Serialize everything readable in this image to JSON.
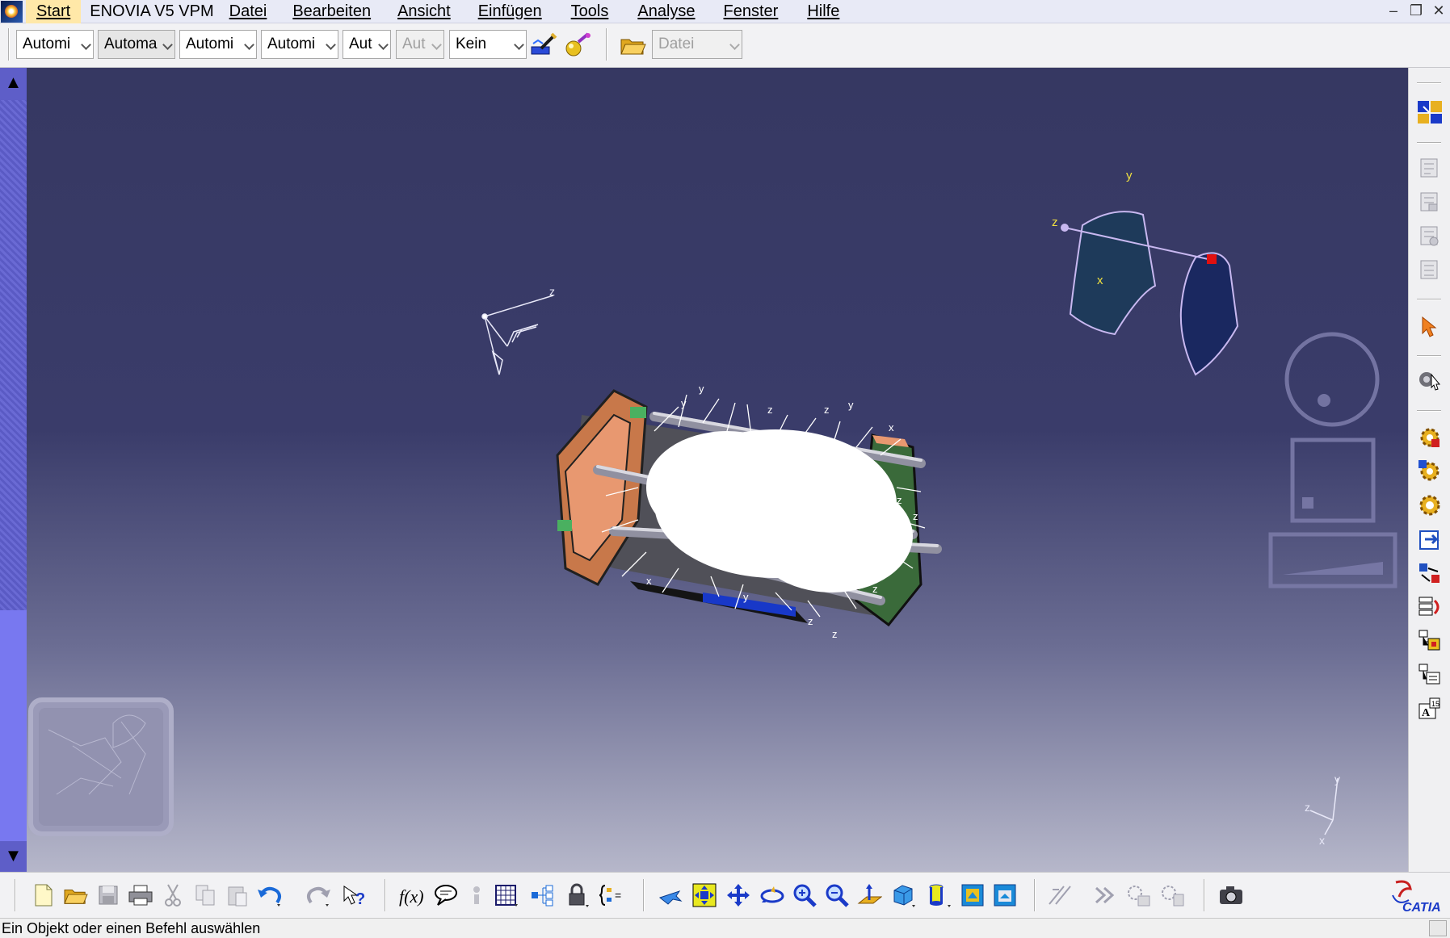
{
  "menubar": {
    "items": [
      "Start",
      "ENOVIA V5 VPM",
      "Datei",
      "Bearbeiten",
      "Ansicht",
      "Einfügen",
      "Tools",
      "Analyse",
      "Fenster",
      "Hilfe"
    ]
  },
  "toolbar_top": {
    "combos": [
      "Automi",
      "Automa",
      "Automi",
      "Automi",
      "Aut",
      "Aut",
      "Kein"
    ],
    "file_combo": "Datei",
    "icons": [
      "format-painter-icon",
      "apply-material-icon",
      "open-folder-icon"
    ]
  },
  "viewport": {
    "background_top": "#363862",
    "background_bottom": "#b6b7ca",
    "compass_labels": {
      "y": "y",
      "z": "z",
      "x": "x"
    },
    "axis_labels": {
      "y": "y",
      "z": "z",
      "x": "x"
    },
    "ref_axis_label": "z"
  },
  "toolbar_right": {
    "icons": [
      "product-structure-icon",
      "component-icon-1",
      "component-icon-2",
      "component-icon-3",
      "component-icon-4",
      "select-arrow-icon",
      "manipulate-icon",
      "gear-icon-1",
      "gear-icon-2",
      "gear-icon-3",
      "import-icon",
      "replace-icon",
      "reorder-icon",
      "graph-tree-icon",
      "multi-instantiate-icon",
      "text-icon"
    ]
  },
  "toolbar_bottom": {
    "icons": [
      "new-icon",
      "open-icon",
      "save-icon",
      "print-icon",
      "cut-icon",
      "copy-icon",
      "paste-icon",
      "undo-icon",
      "redo-icon",
      "whats-this-icon",
      "formula-icon",
      "comment-icon",
      "knowledge-icon",
      "table-icon",
      "tree-icon",
      "lock-icon",
      "parameters-icon",
      "fly-mode-icon",
      "fit-all-icon",
      "pan-icon",
      "rotate-icon",
      "zoom-in-icon",
      "zoom-out-icon",
      "normal-view-icon",
      "iso-view-icon",
      "shading-icon",
      "hide-show-icon",
      "swap-visible-icon",
      "measure-icon",
      "snap-icon",
      "move-icon-1",
      "move-icon-2",
      "capture-icon"
    ],
    "brand": "CATIA"
  },
  "statusbar": {
    "text": "Ein Objekt oder einen Befehl auswählen"
  },
  "colors": {
    "menubar_bg": "#e8eaf6",
    "scroll_blue": "#5e5ec8",
    "compass_fill": "#1e3a5a",
    "compass_outline": "#c8b8f0",
    "axis_yellow": "#f0e040"
  }
}
